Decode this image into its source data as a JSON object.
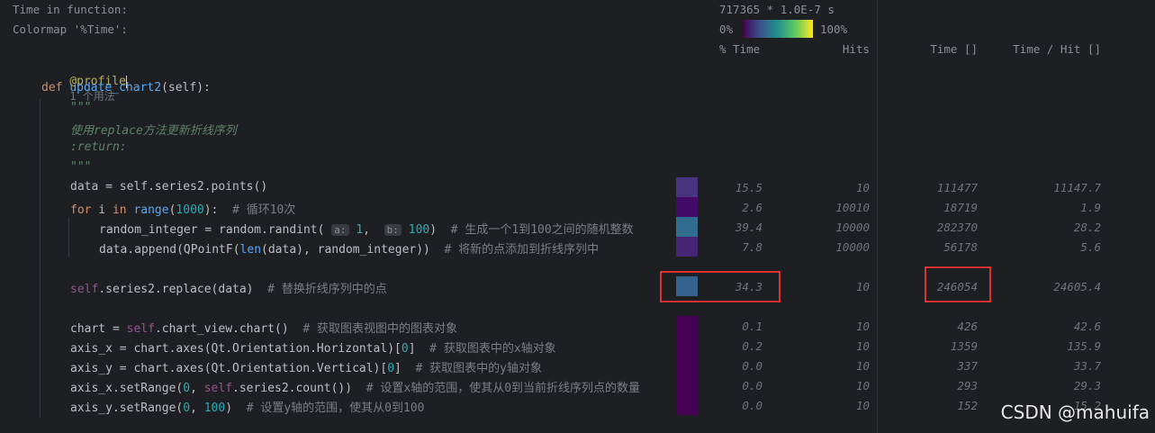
{
  "header": {
    "time_label": "Time in function:",
    "time_value": "717365 * 1.0E-7 s",
    "colormap_label": "Colormap '%Time':",
    "colormap_min": "0%",
    "colormap_max": "100%",
    "col_pct_time": "% Time",
    "col_hits": "Hits",
    "col_time": "Time []",
    "col_time_per_hit": "Time / Hit []"
  },
  "code": {
    "decorator": "@profile",
    "usage_hint": "1 个用法",
    "def_kw": "def",
    "func_name": "update_chart2",
    "func_params": "(self):",
    "doc_open": "\"\"\"",
    "doc_line1": "使用replace方法更新折线序列",
    "doc_line2": ":return:",
    "doc_close": "\"\"\"",
    "lines": [
      {
        "text": "data = self.series2.points()"
      },
      {
        "text": "for i in range(1000):  # 循环10次"
      },
      {
        "text": "random_integer = random.randint( a: 1,  b: 100)  # 生成一个1到100之间的随机整数"
      },
      {
        "text": "data.append(QPointF(len(data), random_integer))  # 将新的点添加到折线序列中"
      },
      {
        "text": "self.series2.replace(data)  # 替换折线序列中的点"
      },
      {
        "text": "chart = self.chart_view.chart()  # 获取图表视图中的图表对象"
      },
      {
        "text": "axis_x = chart.axes(Qt.Orientation.Horizontal)[0]  # 获取图表中的x轴对象"
      },
      {
        "text": "axis_y = chart.axes(Qt.Orientation.Vertical)[0]  # 获取图表中的y轴对象"
      },
      {
        "text": "axis_x.setRange(0, self.series2.count())  # 设置x轴的范围，使其从0到当前折线序列点的数量"
      },
      {
        "text": "axis_y.setRange(0, 100)  # 设置y轴的范围，使其从0到100"
      }
    ]
  },
  "stats": [
    {
      "pct": "15.5",
      "hits": "10",
      "time": "111477",
      "per_hit": "11147.7",
      "color": "#463480"
    },
    {
      "pct": "2.6",
      "hits": "10010",
      "time": "18719",
      "per_hit": "1.9",
      "color": "#440a68"
    },
    {
      "pct": "39.4",
      "hits": "10000",
      "time": "282370",
      "per_hit": "28.2",
      "color": "#2f6c8e"
    },
    {
      "pct": "7.8",
      "hits": "10000",
      "time": "56178",
      "per_hit": "5.6",
      "color": "#472575"
    },
    {
      "pct": "34.3",
      "hits": "10",
      "time": "246054",
      "per_hit": "24605.4",
      "color": "#33638d"
    },
    {
      "pct": "0.1",
      "hits": "10",
      "time": "426",
      "per_hit": "42.6",
      "color": "#440154"
    },
    {
      "pct": "0.2",
      "hits": "10",
      "time": "1359",
      "per_hit": "135.9",
      "color": "#440154"
    },
    {
      "pct": "0.0",
      "hits": "10",
      "time": "337",
      "per_hit": "33.7",
      "color": "#440154"
    },
    {
      "pct": "0.0",
      "hits": "10",
      "time": "293",
      "per_hit": "29.3",
      "color": "#440154"
    },
    {
      "pct": "0.0",
      "hits": "10",
      "time": "152",
      "per_hit": "15.2",
      "color": "#440154"
    }
  ],
  "watermark": "CSDN @mahuifa"
}
